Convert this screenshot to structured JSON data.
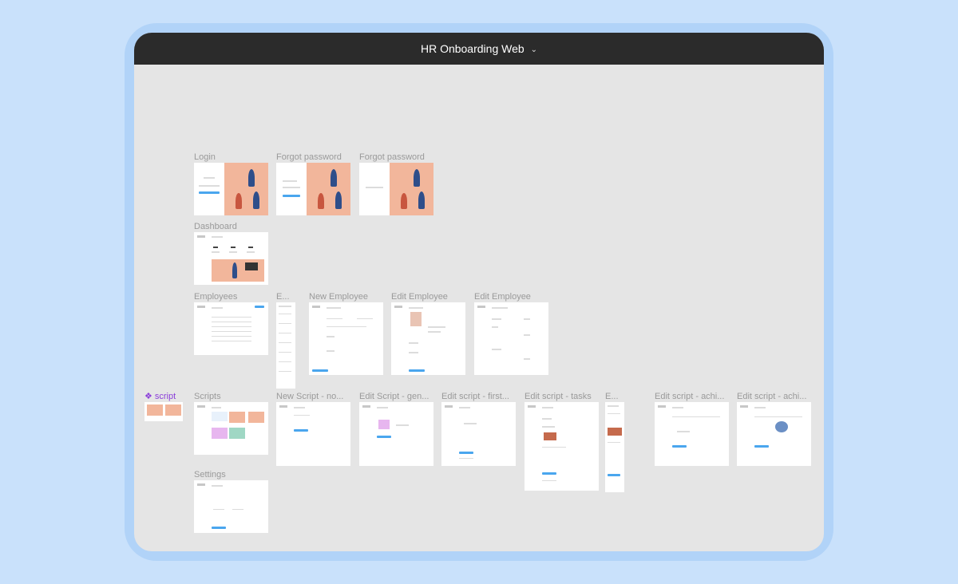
{
  "window": {
    "title": "HR Onboarding Web"
  },
  "component": {
    "name": "script"
  },
  "frames": {
    "login": "Login",
    "forgot1": "Forgot password",
    "forgot2": "Forgot password",
    "dashboard": "Dashboard",
    "employees": "Employees",
    "employee_mobile": "E...",
    "new_employee": "New Employee",
    "edit_employee1": "Edit Employee",
    "edit_employee2": "Edit Employee",
    "scripts": "Scripts",
    "new_script": "New Script - no...",
    "edit_script_gen": "Edit Script - gen...",
    "edit_script_first": "Edit script - first...",
    "edit_script_tasks": "Edit script - tasks",
    "edit_script_mobile": "E...",
    "edit_script_achi1": "Edit script - achi...",
    "edit_script_achi2": "Edit script - achi...",
    "settings": "Settings"
  },
  "colors": {
    "accent": "#4aa6ee",
    "peach": "#f2b69b",
    "component": "#8b3fd9"
  }
}
